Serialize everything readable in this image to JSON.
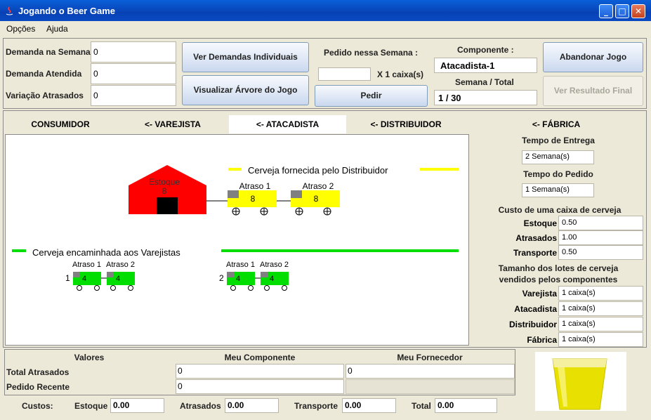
{
  "window": {
    "title": "Jogando o Beer Game"
  },
  "menu": [
    "Opções",
    "Ajuda"
  ],
  "top": {
    "demanda_semana_label": "Demanda na Semana",
    "demanda_semana_value": "0",
    "demanda_atendida_label": "Demanda Atendida",
    "demanda_atendida_value": "0",
    "variacao_label": "Variação Atrasados",
    "variacao_value": "0",
    "ver_demandas_button": "Ver Demandas Individuais",
    "visualizar_arvore_button": "Visualizar Árvore do Jogo",
    "pedido_label": "Pedido nessa Semana :",
    "pedido_value": "",
    "caixas_label": "X 1 caixa(s)",
    "pedir_button": "Pedir",
    "componente_label": "Componente :",
    "componente_value": "Atacadista-1",
    "semana_label": "Semana / Total",
    "semana_value": "1 / 30",
    "abandonar_button": "Abandonar Jogo",
    "ver_resultado_button": "Ver Resultado Final"
  },
  "tabs": [
    {
      "label": "CONSUMIDOR",
      "active": false
    },
    {
      "label": "<- VAREJISTA",
      "active": false
    },
    {
      "label": "<- ATACADISTA",
      "active": true
    },
    {
      "label": "<- DISTRIBUIDOR",
      "active": false
    },
    {
      "label": "<- FÁBRICA",
      "active": false
    }
  ],
  "diagram": {
    "legend_supplied": "Cerveja fornecida pelo Distribuidor",
    "legend_forwarded": "Cerveja encaminhada aos Varejistas",
    "warehouse_label": "Estoque",
    "warehouse_value": "8",
    "delay1_label": "Atraso 1",
    "delay1_value": "8",
    "delay2_label": "Atraso 2",
    "delay2_value": "8",
    "retailers": [
      {
        "index": "1",
        "delay1_label": "Atraso 1",
        "delay2_label": "Atraso 2",
        "delay1_value": "4",
        "delay2_value": "4"
      },
      {
        "index": "2",
        "delay1_label": "Atraso 1",
        "delay2_label": "Atraso 2",
        "delay1_value": "4",
        "delay2_value": "4"
      }
    ],
    "colors": {
      "warehouse": "#FF0000",
      "supplied": "#FFFF00",
      "forwarded": "#00DD00",
      "door": "#000000",
      "cab": "#808080"
    }
  },
  "side": {
    "tempo_entrega_label": "Tempo de Entrega",
    "tempo_entrega_value": "2 Semana(s)",
    "tempo_pedido_label": "Tempo do Pedido",
    "tempo_pedido_value": "1 Semana(s)",
    "custo_label": "Custo de uma caixa de cerveja",
    "custos": [
      {
        "label": "Estoque",
        "value": "0.50"
      },
      {
        "label": "Atrasados",
        "value": "1.00"
      },
      {
        "label": "Transporte",
        "value": "0.50"
      }
    ],
    "lotes_label_1": "Tamanho dos lotes de cerveja",
    "lotes_label_2": "vendidos pelos componentes",
    "lotes": [
      {
        "label": "Varejista",
        "value": "1 caixa(s)"
      },
      {
        "label": "Atacadista",
        "value": "1 caixa(s)"
      },
      {
        "label": "Distribuidor",
        "value": "1 caixa(s)"
      },
      {
        "label": "Fábrica",
        "value": "1 caixa(s)"
      }
    ]
  },
  "bottom_table": {
    "headers": [
      "Valores",
      "Meu Componente",
      "Meu Fornecedor"
    ],
    "rows": [
      {
        "label": "Total Atrasados",
        "mine": "0",
        "supplier": "0"
      },
      {
        "label": "Pedido Recente",
        "mine": "0",
        "supplier": ""
      }
    ]
  },
  "costs_bar": {
    "label": "Custos:",
    "items": [
      {
        "label": "Estoque",
        "value": "0.00"
      },
      {
        "label": "Atrasados",
        "value": "0.00"
      },
      {
        "label": "Transporte",
        "value": "0.00"
      },
      {
        "label": "Total",
        "value": "0.00"
      }
    ]
  },
  "beer_glass": {
    "fill_color": "#E8E000"
  }
}
